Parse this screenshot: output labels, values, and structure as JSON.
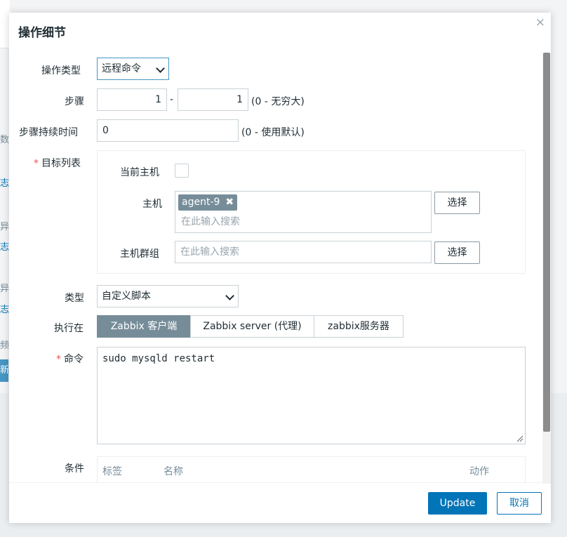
{
  "background": {
    "side_texts": [
      "数",
      "志",
      "异",
      "志",
      "异",
      "志",
      "频率"
    ],
    "button_label": "新"
  },
  "dialog": {
    "title": "操作细节",
    "close_glyph": "×"
  },
  "form": {
    "operation_type": {
      "label": "操作类型",
      "value": "远程命令"
    },
    "steps": {
      "label": "步骤",
      "from": "1",
      "separator": "-",
      "to": "1",
      "hint": "(0 - 无穷大)"
    },
    "step_duration": {
      "label": "步骤持续时间",
      "value": "0",
      "hint": "(0 - 使用默认)"
    },
    "target_list": {
      "required_mark": "*",
      "label": "目标列表",
      "current_host_label": "当前主机",
      "host_label": "主机",
      "host_tag": "agent-9",
      "host_tag_remove": "✖",
      "host_placeholder": "在此输入搜索",
      "host_select_button": "选择",
      "hostgroup_label": "主机群组",
      "hostgroup_placeholder": "在此输入搜索",
      "hostgroup_select_button": "选择"
    },
    "type": {
      "label": "类型",
      "value": "自定义脚本"
    },
    "execute_on": {
      "label": "执行在",
      "options": [
        "Zabbix 客户端",
        "Zabbix server (代理)",
        "zabbix服务器"
      ],
      "selected": "Zabbix 客户端"
    },
    "command": {
      "required_mark": "*",
      "label": "命令",
      "value": "sudo mysqld restart"
    },
    "conditions": {
      "label": "条件",
      "columns": [
        "标签",
        "名称",
        "动作"
      ]
    }
  },
  "footer": {
    "update_label": "Update",
    "cancel_label": "取消"
  },
  "colors": {
    "primary": "#0275b8",
    "tag_bg": "#768d99",
    "required": "#e45959",
    "scroll_thumb": "#8c8c8c"
  }
}
